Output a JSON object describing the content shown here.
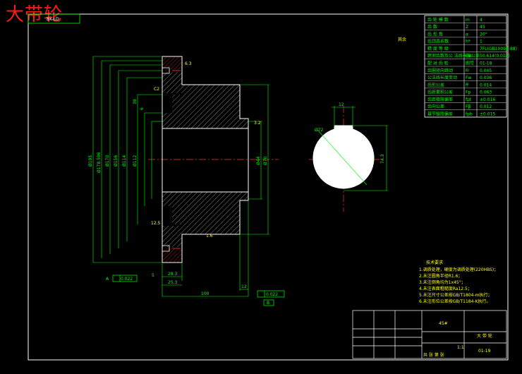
{
  "title": "大带轮",
  "drawing_code_box": "BK-LD",
  "roughness_top_right": "其余",
  "dims": {
    "d1": "Ø195",
    "d2": "Ø178.596",
    "d3": "Ø170",
    "d4": "Ø156",
    "d5": "Ø114",
    "d6": "Ø112",
    "d7": "Ø44",
    "d8": "Ø70",
    "d_38": "38",
    "d_6": "6",
    "len_100": "100",
    "len_12": "12",
    "len_28": "28.3",
    "len_25": "25.3",
    "len_5": "5",
    "key_width": "12",
    "key_height": "74.3",
    "circle_dia": "Ø72",
    "tol_a": "0.022",
    "tol_b": "0.022",
    "datum_a": "A",
    "datum_b": "B",
    "ra_a": "6.3",
    "ra_b": "3.2",
    "ra_c": "1.6",
    "ra_d": "12.5",
    "chamfer": "C2"
  },
  "param_table": [
    [
      "齿 轮 模 数",
      "m",
      "4"
    ],
    [
      "齿    数",
      "Z",
      "45"
    ],
    [
      "齿 形 角",
      "α",
      "20°"
    ],
    [
      "齿顶高系数",
      "h*",
      "1"
    ],
    [
      "精 度 等 级",
      "",
      "7FL(GB10095-88)"
    ],
    [
      "跨测齿数及公\n法线长度公差",
      "Ew",
      "50.614(0.018)"
    ],
    [
      "配 对 齿 轮",
      "图号",
      "01-18"
    ],
    [
      "齿圈径向跳动",
      "Fr",
      "0.045"
    ],
    [
      "公法线长度变动",
      "Fw",
      "0.036"
    ],
    [
      "齿形公差",
      "ff",
      "0.014"
    ],
    [
      "齿距累积公差",
      "Fp",
      "0.063"
    ],
    [
      "齿距极限偏差",
      "fpt",
      "±0.016"
    ],
    [
      "齿向公差",
      "Fβ",
      "0.012"
    ],
    [
      "基节极限偏差",
      "fpb",
      "±0.015"
    ]
  ],
  "notes": {
    "heading": "技术要求",
    "lines": [
      "1.调质处理，硬度为调质处理(220HBS)；",
      "2.未注圆角半径R1.6；",
      "3.未注倒角均为1x45°；",
      "4.未注表面粗糙度Ra12.5；",
      "5.未注尺寸公差按GB/T1804-m执行；",
      "6.未注形位公差按GB/T1184-K执行。"
    ]
  },
  "title_block": {
    "material": "45#",
    "part_name": "大 带 轮",
    "drawing_no": "01-19",
    "scale": "1:1",
    "sheet": "共 张 第 张"
  }
}
